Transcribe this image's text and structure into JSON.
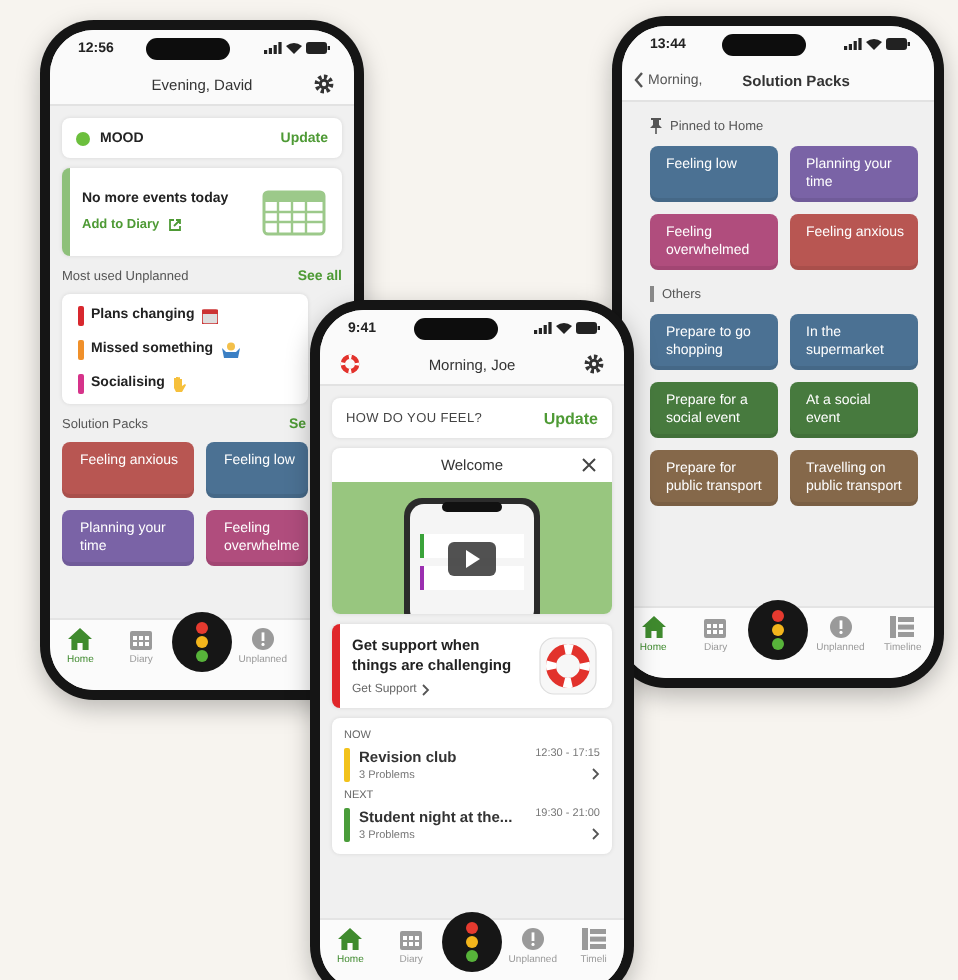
{
  "home_evening": {
    "status_time": "12:56",
    "title": "Evening, David",
    "mood": {
      "label": "MOOD",
      "action": "Update"
    },
    "events": {
      "message": "No more events today",
      "link": "Add to Diary"
    },
    "unplanned": {
      "heading": "Most used Unplanned",
      "action": "See all",
      "items": [
        {
          "label": "Plans changing",
          "color": "#d8282e",
          "kind": "calendar"
        },
        {
          "label": "Missed something",
          "color": "#f0902a",
          "kind": "person"
        },
        {
          "label": "Socialising",
          "color": "#d6338a",
          "kind": "hand"
        }
      ]
    },
    "packs": {
      "heading": "Solution Packs",
      "action": "Se",
      "items": [
        {
          "label": "Feeling anxious",
          "color": "#b85652"
        },
        {
          "label": "Feeling low",
          "color": "#4b7193"
        },
        {
          "label": "Planning your time",
          "color": "#7a63a6"
        },
        {
          "label": "Feeling overwhelme",
          "color": "#b04d7d"
        }
      ]
    },
    "tabs": [
      {
        "label": "Home",
        "kind": "home",
        "selected": true
      },
      {
        "label": "Diary",
        "kind": "diary",
        "selected": false
      },
      {
        "label": "Unplanned",
        "kind": "unplanned",
        "selected": false
      }
    ]
  },
  "solution_packs_screen": {
    "status_time": "13:44",
    "back": "Morning,",
    "title": "Solution Packs",
    "pinned": {
      "heading": "Pinned to Home",
      "items": [
        {
          "label": "Feeling low",
          "color": "#4b7193"
        },
        {
          "label": "Planning your time",
          "color": "#7a63a6"
        },
        {
          "label": "Feeling overwhelmed",
          "color": "#b04d7d"
        },
        {
          "label": "Feeling anxious",
          "color": "#b85652"
        }
      ]
    },
    "others": {
      "heading": "Others",
      "items": [
        {
          "label": "Prepare to go shopping",
          "color": "#4b7193"
        },
        {
          "label": "In the supermarket",
          "color": "#4b7193"
        },
        {
          "label": "Prepare for a social event",
          "color": "#477a3e"
        },
        {
          "label": "At a social event",
          "color": "#477a3e"
        },
        {
          "label": "Prepare for public transport",
          "color": "#85684a"
        },
        {
          "label": "Travelling on public transport",
          "color": "#85684a"
        }
      ]
    },
    "tabs": [
      {
        "label": "Home",
        "kind": "home",
        "selected": true
      },
      {
        "label": "Diary",
        "kind": "diary",
        "selected": false
      },
      {
        "label": "Unplanned",
        "kind": "unplanned",
        "selected": false
      },
      {
        "label": "Timeline",
        "kind": "timeline",
        "selected": false
      }
    ]
  },
  "home_morning": {
    "status_time": "9:41",
    "title": "Morning, Joe",
    "feel": {
      "label": "HOW DO YOU FEEL?",
      "action": "Update"
    },
    "welcome": {
      "title": "Welcome"
    },
    "support": {
      "message": "Get support when things are challenging",
      "link": "Get Support"
    },
    "agenda": [
      {
        "heading": "NOW",
        "title": "Revision club",
        "detail": "3 Problems",
        "time": "12:30 - 17:15",
        "color": "#f2c21b"
      },
      {
        "heading": "NEXT",
        "title": "Student night at the...",
        "detail": "3 Problems",
        "time": "19:30 - 21:00",
        "color": "#4a9c3a"
      }
    ],
    "tabs": [
      {
        "label": "Home",
        "kind": "home",
        "selected": true
      },
      {
        "label": "Diary",
        "kind": "diary",
        "selected": false
      },
      {
        "label": "Unplanned",
        "kind": "unplanned",
        "selected": false
      },
      {
        "label": "Timeli",
        "kind": "timeline",
        "selected": false
      }
    ]
  }
}
